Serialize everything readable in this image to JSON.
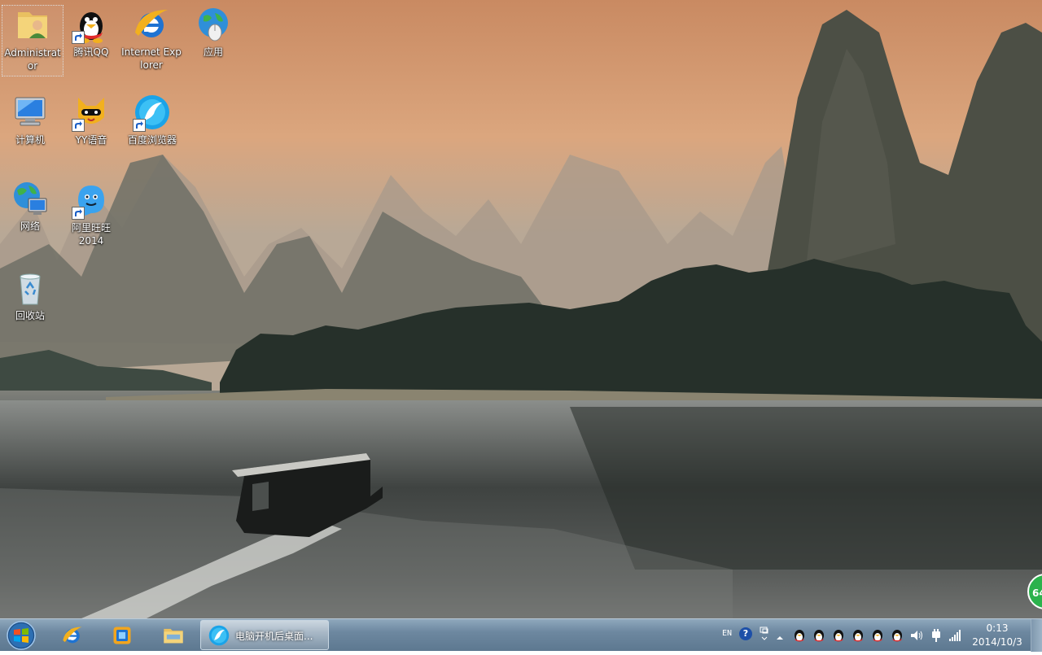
{
  "desktop": {
    "icons": [
      {
        "label": "Administrator",
        "icon": "user-folder-icon",
        "selected": true
      },
      {
        "label": "腾讯QQ",
        "icon": "qq-penguin-icon",
        "shortcut": true
      },
      {
        "label": "Internet Explorer",
        "icon": "internet-explorer-icon"
      },
      {
        "label": "应用",
        "icon": "globe-mouse-icon"
      },
      {
        "label": "计算机",
        "icon": "computer-icon"
      },
      {
        "label": "YY语音",
        "icon": "yy-voice-icon",
        "shortcut": true
      },
      {
        "label": "百度浏览器",
        "icon": "baidu-browser-icon",
        "shortcut": true
      },
      {
        "label": "网络",
        "icon": "network-globe-icon"
      },
      {
        "label": "阿里旺旺 2014",
        "icon": "aliwangwang-icon",
        "shortcut": true
      },
      {
        "label": "回收站",
        "icon": "recycle-bin-icon"
      }
    ],
    "gadget_text": "64"
  },
  "taskbar": {
    "start": "start-orb-icon",
    "pinned": [
      "internet-explorer-icon",
      "media-center-icon",
      "file-explorer-icon"
    ],
    "active_task": {
      "label": "电脑开机后桌面...",
      "icon": "baidu-browser-icon"
    },
    "tray": {
      "language": "EN",
      "help": "?",
      "ime": "ime-icon",
      "penguin_count": 6,
      "clock_time": "0:13",
      "clock_date": "2014/10/3"
    }
  },
  "colors": {
    "taskbar": "#6d88a0",
    "qq_yellow": "#f2b01e",
    "ie_blue": "#1e73d2"
  }
}
